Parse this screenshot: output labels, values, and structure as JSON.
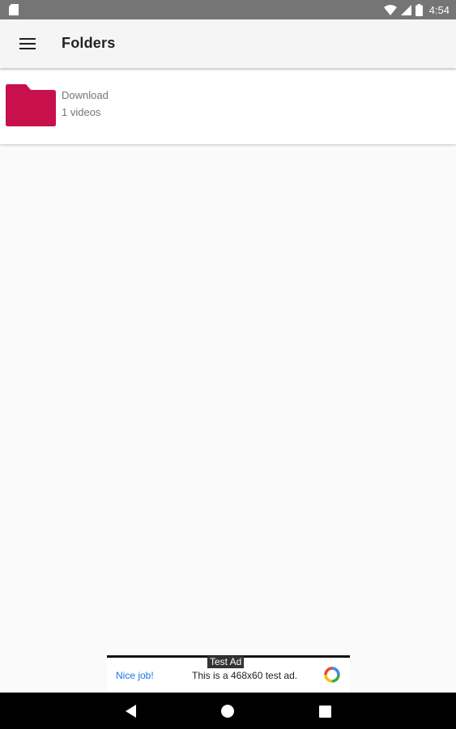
{
  "status_bar": {
    "time": "4:54",
    "icons": [
      "sd-card-icon",
      "wifi-icon",
      "signal-icon",
      "battery-icon"
    ]
  },
  "app_bar": {
    "title": "Folders",
    "menu_icon": "menu-icon"
  },
  "folders": [
    {
      "name": "Download",
      "count": "1 videos",
      "icon": "folder-icon",
      "color": "#c8104c"
    }
  ],
  "ad": {
    "tag": "Test Ad",
    "nice_label": "Nice job!",
    "text": "This is a 468x60 test ad.",
    "logo": "ad-logo-icon"
  },
  "nav": {
    "back": "back-icon",
    "home": "home-icon",
    "recents": "recents-icon"
  },
  "colors": {
    "status_bar": "#757575",
    "app_bar": "#f5f5f5",
    "background": "#fafafa",
    "accent": "#c8104c",
    "link": "#1a73e8"
  }
}
